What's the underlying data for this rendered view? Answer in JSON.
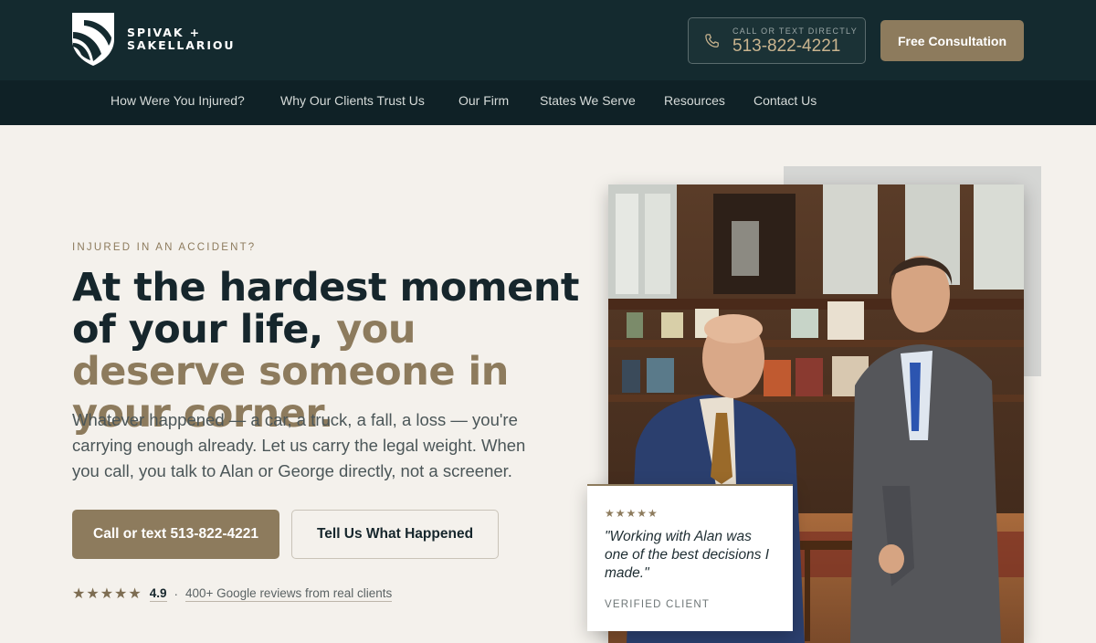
{
  "header": {
    "logo_line1": "SPIVAK +",
    "logo_line2": "SAKELLARIOU",
    "phone_label": "CALL OR TEXT DIRECTLY",
    "phone_number": "513-822-4221",
    "cta_label": "Free Consultation"
  },
  "nav": {
    "items": [
      {
        "label": "How Were You Injured?"
      },
      {
        "label": "Why Our Clients Trust Us"
      },
      {
        "label": "Our Firm"
      },
      {
        "label": "States We Serve"
      },
      {
        "label": "Resources"
      },
      {
        "label": "Contact Us"
      }
    ]
  },
  "hero": {
    "eyebrow": "INJURED IN AN ACCIDENT?",
    "headline_part1": "At the hardest moment of your life,",
    "headline_part2": "you deserve someone in your corner.",
    "body": "Whatever happened — a car, a truck, a fall, a loss — you're carrying enough already. Let us carry the legal weight. When you call, you talk to Alan or George directly, not a screener.",
    "primary_cta": "Call or text 513-822-4221",
    "secondary_cta": "Tell Us What Happened",
    "rating_stars": "★★★★★",
    "rating_score": "4.9",
    "rating_separator": "·",
    "rating_text": "400+ Google reviews from real clients"
  },
  "testimonial": {
    "stars": "★★★★★",
    "quote": "\"Working with Alan was one of the best decisions I made.\"",
    "author": "VERIFIED CLIENT"
  },
  "colors": {
    "header_bg": "#142a2f",
    "nav_bg": "#0f2126",
    "accent_gold": "#8d7b5d",
    "page_bg": "#f4f1ec"
  },
  "icons": [
    "shield-logo-icon",
    "phone-icon",
    "star-icon"
  ]
}
